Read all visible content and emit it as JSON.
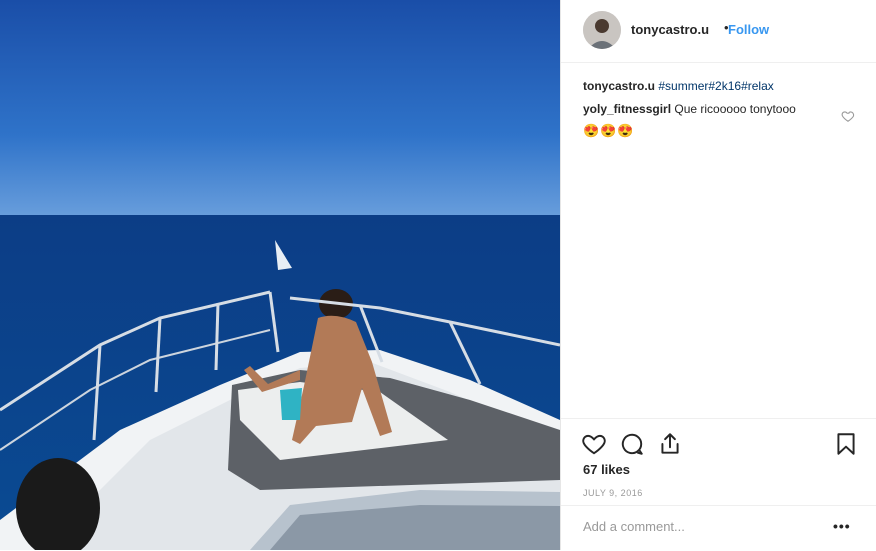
{
  "post": {
    "username": "tonycastro.u",
    "separator": "•",
    "follow_label": "Follow"
  },
  "caption": {
    "username": "tonycastro.u",
    "hashtags": "#summer#2k16#relax"
  },
  "comment": {
    "username": "yoly_fitnessgirl",
    "text": "Que ricooooo tonytooo",
    "emojis": "😍😍😍"
  },
  "actions": {
    "like_icon": "heart-icon",
    "comment_icon": "comment-icon",
    "share_icon": "share-icon",
    "save_icon": "bookmark-icon"
  },
  "likes": "67 likes",
  "date": "JULY 9, 2016",
  "add_comment": {
    "placeholder": "Add a comment...",
    "more_label": "•••"
  }
}
